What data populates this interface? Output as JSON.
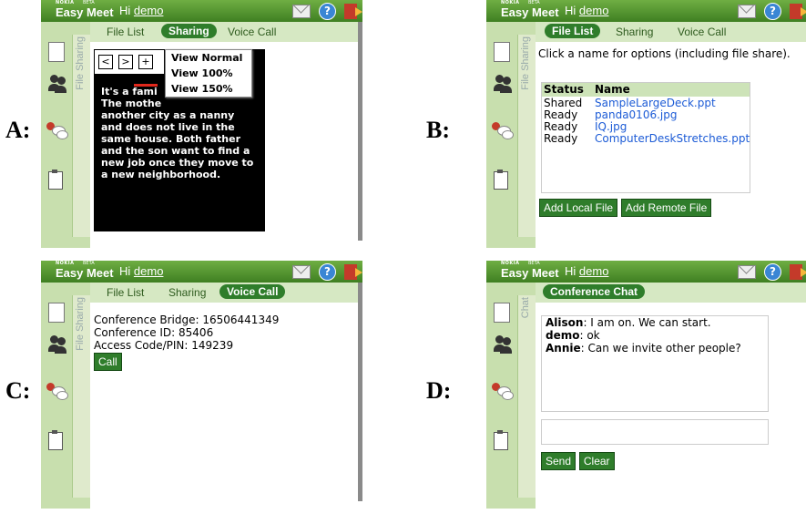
{
  "labels": {
    "A": "A:",
    "B": "B:",
    "C": "C:",
    "D": "D:"
  },
  "app": {
    "brand_small": "NOKIA",
    "beta": "BETA",
    "name": "Easy Meet",
    "hi": "Hi",
    "user": "demo",
    "help_glyph": "?"
  },
  "sidebar_tab": {
    "file_sharing": "File Sharing",
    "chat": "Chat"
  },
  "tabs": {
    "file_list": "File List",
    "sharing": "Sharing",
    "voice_call": "Voice Call",
    "conference_chat": "Conference Chat"
  },
  "panel_a": {
    "nav": {
      "prev": "<",
      "next": ">",
      "plus": "+"
    },
    "menu": [
      "View Normal",
      "View 100%",
      "View 150%"
    ],
    "slide_lines": [
      "It's a fami",
      "The mothe",
      "another city as a nanny",
      "and does not live in the",
      "same house. Both father",
      "and the son want to find a",
      "new job once they move to",
      "a new neighborhood."
    ]
  },
  "panel_b": {
    "instruction": "Click a name for options (including file share).",
    "columns": [
      "Status",
      "Name"
    ],
    "files": [
      {
        "status": "Shared",
        "name": "SampleLargeDeck.ppt"
      },
      {
        "status": "Ready",
        "name": "panda0106.jpg"
      },
      {
        "status": "Ready",
        "name": "IQ.jpg"
      },
      {
        "status": "Ready",
        "name": "ComputerDeskStretches.ppt"
      }
    ],
    "add_local": "Add Local File",
    "add_remote": "Add Remote File"
  },
  "panel_c": {
    "bridge": "Conference Bridge: 16506441349",
    "conf_id": "Conference ID: 85406",
    "access": "Access Code/PIN: 149239",
    "call": "Call"
  },
  "panel_d": {
    "messages": [
      {
        "who": "Alison",
        "text": ": I am on. We can start."
      },
      {
        "who": "demo",
        "text": ": ok"
      },
      {
        "who": "Annie",
        "text": ": Can we invite other people?"
      }
    ],
    "input_value": "",
    "send": "Send",
    "clear": "Clear"
  },
  "colors": {
    "header_green": "#3f7f22",
    "tab_green": "#2f7d2b",
    "sidebar": "#c8dfae",
    "link": "#1c5bd6"
  }
}
